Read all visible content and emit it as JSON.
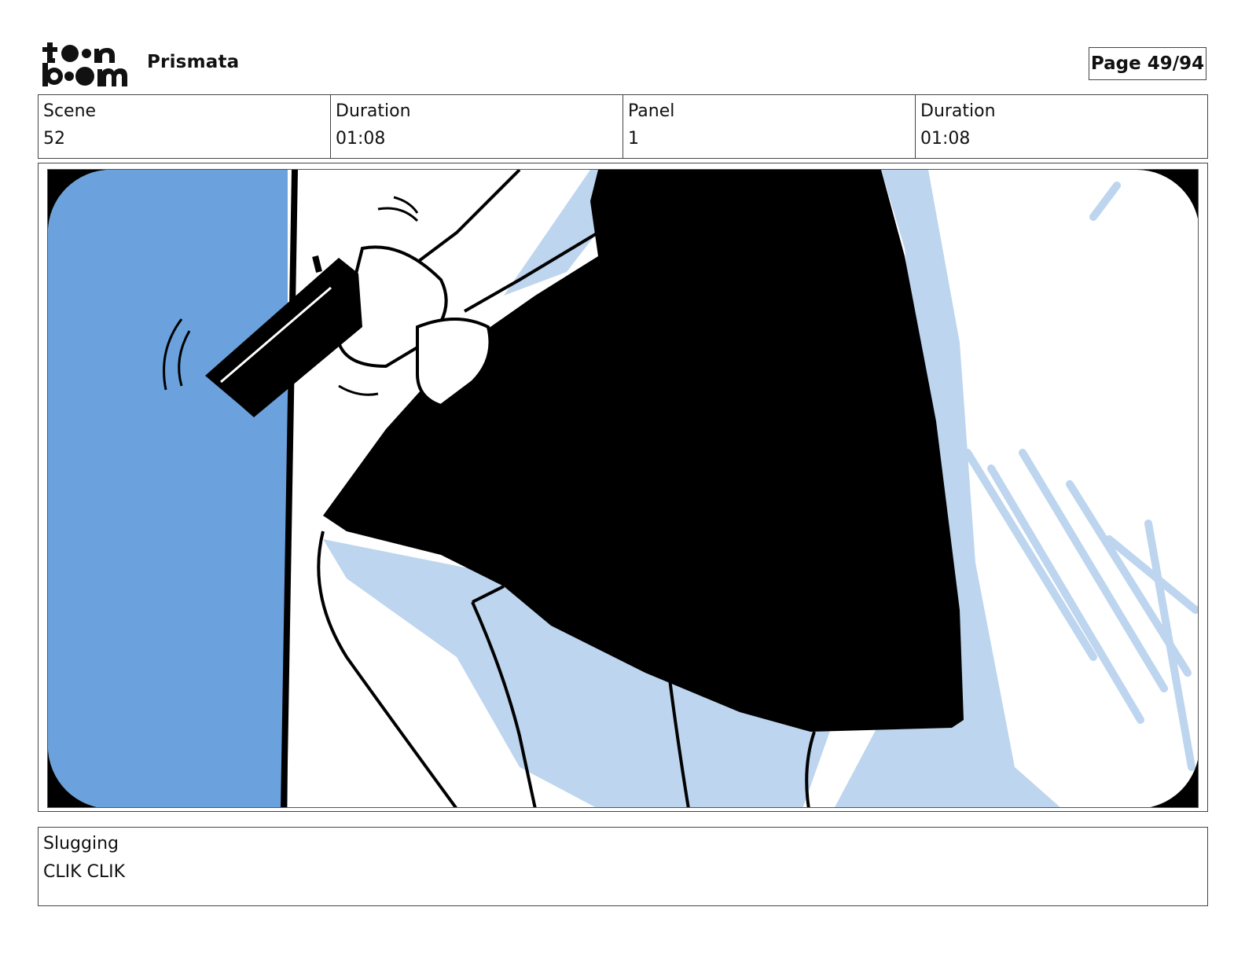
{
  "header": {
    "logo_name": "toon boom logo",
    "project_title": "Prismata",
    "page_indicator": "Page 49/94"
  },
  "info": {
    "scene_label": "Scene",
    "scene_value": "52",
    "scene_duration_label": "Duration",
    "scene_duration_value": "01:08",
    "panel_label": "Panel",
    "panel_value": "1",
    "panel_duration_label": "Duration",
    "panel_duration_value": "01:08"
  },
  "panel_image": {
    "icon": "storyboard-panel-drawing",
    "colors": {
      "wall_blue": "#6ba1dc",
      "shadow_blue": "#bdd5ee",
      "ink": "#000000",
      "paper": "#ffffff"
    }
  },
  "notes": {
    "label": "Slugging",
    "text": "CLIK CLIK"
  }
}
